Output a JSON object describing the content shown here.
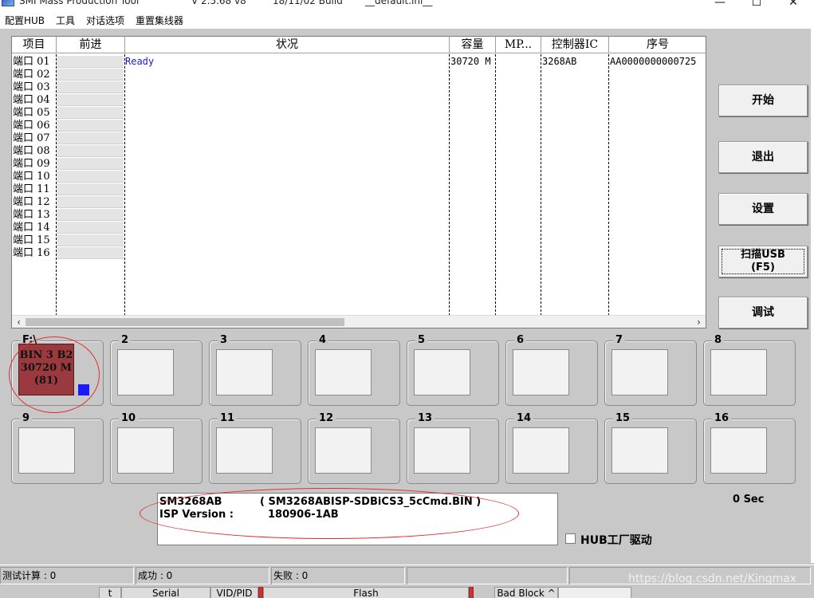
{
  "titlebar": {
    "app_name": "SMI Mass Production Tool",
    "version": "V 2.5.68   v8",
    "build": "18/11/02 Build",
    "config_file": "__default.ini__",
    "minimize": "—",
    "maximize": "☐",
    "close": "✕"
  },
  "menu": [
    "配置HUB",
    "工具",
    "对话选项",
    "重置集线器"
  ],
  "table": {
    "headers": [
      "项目",
      "前进",
      "状况",
      "容量",
      "MP...",
      "控制器IC",
      "序号"
    ],
    "ports": [
      "端口 01",
      "端口 02",
      "端口 03",
      "端口 04",
      "端口 05",
      "端口 06",
      "端口 07",
      "端口 08",
      "端口 09",
      "端口 10",
      "端口 11",
      "端口 12",
      "端口 13",
      "端口 14",
      "端口 15",
      "端口 16"
    ],
    "row1": {
      "status": "Ready",
      "capacity": "30720 M",
      "controller": "3268AB",
      "serial": "AA0000000000725"
    }
  },
  "buttons": {
    "start": "开始",
    "exit": "退出",
    "settings": "设置",
    "scan_line1": "扫描USB",
    "scan_line2": "(F5)",
    "debug": "调试"
  },
  "port_boxes": [
    "F:\\",
    "2",
    "3",
    "4",
    "5",
    "6",
    "7",
    "8",
    "9",
    "10",
    "11",
    "12",
    "13",
    "14",
    "15",
    "16"
  ],
  "active_port": {
    "line1": "BIN 3 B2",
    "line2": "30720 M",
    "line3": "(81)"
  },
  "info": {
    "controller": "SM3268AB",
    "isp_file": "( SM3268ABISP-SDBiCS3_5cCmd.BIN )",
    "isp_label": "ISP Version :",
    "isp_version": "180906-1AB"
  },
  "timer": "0 Sec",
  "hub_label": "HUB工厂驱动",
  "statusbar": {
    "test_count": "测试计算 : 0",
    "success": "成功 : 0",
    "fail": "失败 : 0"
  },
  "taskbar": [
    "t",
    "Serial",
    "VID/PID",
    "Flash",
    "Bad Block ^"
  ],
  "watermark": "https://blog.csdn.net/Kingmax"
}
